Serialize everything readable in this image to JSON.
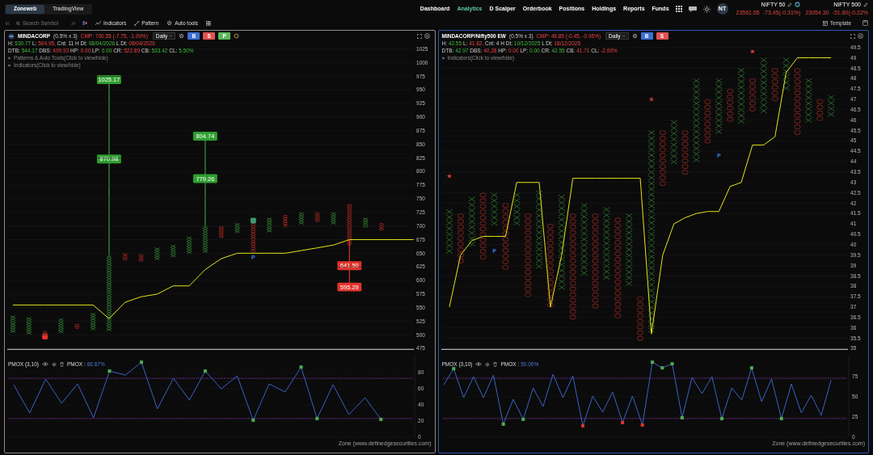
{
  "top_bar": {
    "tabs": [
      {
        "label": "Zoneweb",
        "selected": true
      },
      {
        "label": "TradingView",
        "selected": false
      }
    ],
    "nav": [
      {
        "label": "Dashboard",
        "selected": false
      },
      {
        "label": "Analytics",
        "selected": true
      },
      {
        "label": "D Scalper",
        "selected": false
      },
      {
        "label": "Orderbook",
        "selected": false
      },
      {
        "label": "Positions",
        "selected": false
      },
      {
        "label": "Holdings",
        "selected": false
      },
      {
        "label": "Reports",
        "selected": false
      },
      {
        "label": "Funds",
        "selected": false
      }
    ],
    "avatar": "NT",
    "indices": [
      {
        "name": "NIFTY 50",
        "value": "23561.65",
        "change": "-73.45(-0.31%)"
      },
      {
        "name": "NIFTY 500",
        "value": "23054.30",
        "change": "-51.80(-0.22%"
      }
    ]
  },
  "toolbar": {
    "search": {
      "placeholder": "Search Symbol"
    },
    "tools": [
      "Indicators",
      "Pattern",
      "Auto tools"
    ],
    "template": "Template"
  },
  "panes": [
    {
      "active": false,
      "symbol": "MINDACORP",
      "box": "(0.5% x 3)",
      "cmp": "CMP: 700.55 (-7.75, -1.09%)",
      "interval": "Daily",
      "buttons": [
        {
          "label": "B",
          "color": "#3b6fd4"
        },
        {
          "label": "S",
          "color": "#e05252"
        },
        {
          "label": "P",
          "color": "#5cb85c"
        }
      ],
      "stats": [
        [
          {
            "label": "H:",
            "value": "530.77",
            "kind": "gain"
          },
          {
            "label": "L:",
            "value": "504.95,",
            "kind": "loss"
          },
          {
            "label": "Cnt:",
            "value": "11",
            "kind": "plain"
          },
          {
            "label": "H Dt:",
            "value": "08/04/2026",
            "kind": "gain"
          },
          {
            "label": "L Dt:",
            "value": "08/04/2026",
            "kind": "loss"
          }
        ],
        [
          {
            "label": "DTB:",
            "value": "544.17",
            "kind": "gain"
          },
          {
            "label": "DBS:",
            "value": "499.93",
            "kind": "loss"
          },
          {
            "label": "HP:",
            "value": "0.00",
            "kind": "loss"
          },
          {
            "label": "LP:",
            "value": "0.00",
            "kind": "gain"
          },
          {
            "label": "CR:",
            "value": "522.89",
            "kind": "loss"
          },
          {
            "label": "CB:",
            "value": "533.42",
            "kind": "gain"
          },
          {
            "label": "CL:",
            "value": "5.50%",
            "kind": "gain"
          }
        ]
      ],
      "toggles": [
        "Patterns & Auto Tools(Click to view/hide)",
        "Indicators(Click to view/hide)"
      ],
      "chart_data": {
        "type": "line",
        "grid": true,
        "categories": [
          null,
          null,
          null,
          null,
          null,
          null,
          null,
          null,
          null,
          null,
          null,
          null,
          null,
          null,
          null,
          null,
          null,
          null,
          null,
          null,
          null,
          null,
          null,
          null,
          null,
          null
        ],
        "ylim": [
          475,
          1025
        ],
        "yticks": [
          475,
          500,
          525,
          550,
          575,
          600,
          625,
          650,
          675,
          700,
          725,
          750,
          775,
          800,
          825,
          850,
          875,
          900,
          925,
          950,
          975,
          1000,
          1025
        ],
        "series": [
          {
            "color": "#e5e51a",
            "values": [
              555,
              555,
              555,
              555,
              555,
              555,
              530,
              560,
              570,
              575,
              590,
              590,
              620,
              640,
              650,
              650,
              650,
              650,
              655,
              660,
              665,
              675,
              675,
              675,
              675,
              675
            ]
          }
        ]
      },
      "pnf_columns": [
        {
          "kind": "x"
        },
        {
          "kind": "x"
        },
        {
          "kind": "o"
        },
        {
          "kind": "x"
        },
        {
          "kind": "o"
        },
        {
          "kind": "x"
        },
        {
          "kind": "x"
        },
        {
          "kind": "o"
        },
        {
          "kind": "o"
        },
        {
          "kind": "x"
        },
        {
          "kind": "x"
        },
        {
          "kind": "x"
        },
        {
          "kind": "x"
        },
        {
          "kind": "o"
        },
        {
          "kind": "x"
        },
        {
          "kind": "o"
        },
        {
          "kind": "x"
        },
        {
          "kind": "o"
        },
        {
          "kind": "x"
        },
        {
          "kind": "o"
        },
        {
          "kind": "x"
        },
        {
          "kind": "o"
        },
        {
          "kind": "x"
        },
        {
          "kind": "o"
        }
      ],
      "overlays": [
        {
          "kind": "line",
          "color": "#3c9a3c"
        },
        {
          "kind": "line",
          "color": "#3c9a3c"
        },
        {
          "kind": "line",
          "color": "#e0342c"
        },
        {
          "kind": "label",
          "text": "1025.17",
          "color": "#2f9e2f"
        },
        {
          "kind": "label",
          "text": "870.98",
          "color": "#2f9e2f"
        },
        {
          "kind": "label",
          "text": "804.74",
          "color": "#2f9e2f"
        },
        {
          "kind": "label",
          "text": "779.26",
          "color": "#2f9e2f"
        },
        {
          "kind": "label",
          "text": "641.50",
          "color": "#e0342c"
        },
        {
          "kind": "label",
          "text": "595.29",
          "color": "#e0342c"
        },
        {
          "kind": "badge",
          "color": "#e0342c"
        },
        {
          "kind": "badge",
          "color": "#3c9a6c"
        },
        {
          "kind": "text",
          "text": "P"
        }
      ],
      "indicator": {
        "name": "PMOX (3,10)",
        "reading_label": "PMOX :",
        "reading": "66.67%",
        "chart_data": {
          "type": "line",
          "categories": [
            null,
            null,
            null,
            null,
            null,
            null,
            null,
            null,
            null,
            null,
            null,
            null,
            null,
            null,
            null,
            null,
            null,
            null,
            null,
            null,
            null,
            null,
            null,
            null
          ],
          "ylim": [
            0,
            100
          ],
          "yticks": [
            0,
            20,
            40,
            60,
            80
          ],
          "ref_lines": [
            {
              "axis": "y",
              "value": 73
            },
            {
              "axis": "y",
              "value": 23
            }
          ],
          "series": [
            {
              "color": "#3a62c4",
              "values": [
                65,
                30,
                72,
                42,
                66,
                24,
                82,
                77,
                93,
                35,
                73,
                46,
                82,
                60,
                76,
                21,
                66,
                56,
                87,
                23,
                65,
                28,
                49,
                22
              ]
            }
          ]
        },
        "signals": [
          {
            "kind": "buy"
          },
          {
            "kind": "buy"
          },
          {
            "kind": "buy"
          },
          {
            "kind": "buy"
          },
          {
            "kind": "buy"
          },
          {
            "kind": "buy"
          },
          {
            "kind": "buy"
          }
        ]
      },
      "footer": "Zone (www.definedgesecurities.com)"
    },
    {
      "active": true,
      "symbol": "MINDACORP/Nifty500 EW",
      "box": "(0.5% x 3)",
      "cmp": "CMP: 46.85 (-0.45, -0.95%)",
      "interval": "Daily",
      "buttons": [
        {
          "label": "B",
          "color": "#3b6fd4"
        },
        {
          "label": "S",
          "color": "#e05252"
        }
      ],
      "stats": [
        [
          {
            "label": "H:",
            "value": "42.55",
            "kind": "gain"
          },
          {
            "label": "L:",
            "value": "41.82,",
            "kind": "loss"
          },
          {
            "label": "Cnt:",
            "value": "4",
            "kind": "plain"
          },
          {
            "label": "H Dt:",
            "value": "10/12/2025",
            "kind": "gain"
          },
          {
            "label": "L Dt:",
            "value": "18/12/2025",
            "kind": "loss"
          }
        ],
        [
          {
            "label": "DTB:",
            "value": "42.97",
            "kind": "gain"
          },
          {
            "label": "DBS:",
            "value": "40.28",
            "kind": "loss"
          },
          {
            "label": "HP:",
            "value": "0.00",
            "kind": "loss"
          },
          {
            "label": "LP:",
            "value": "0.00",
            "kind": "gain"
          },
          {
            "label": "CR:",
            "value": "42.55",
            "kind": "gain"
          },
          {
            "label": "CB:",
            "value": "41.71",
            "kind": "loss"
          },
          {
            "label": "CL:",
            "value": "-2.00%",
            "kind": "loss"
          }
        ]
      ],
      "toggles": [
        "Indicators(Click to view/hide)"
      ],
      "chart_data": {
        "type": "line",
        "grid": true,
        "categories": [
          null,
          null,
          null,
          null,
          null,
          null,
          null,
          null,
          null,
          null,
          null,
          null,
          null,
          null,
          null,
          null,
          null,
          null,
          null,
          null,
          null,
          null,
          null,
          null,
          null,
          null,
          null,
          null,
          null,
          null,
          null,
          null,
          null,
          null,
          null
        ],
        "ylim": [
          35,
          49.5
        ],
        "yticks": [
          35,
          35.5,
          36,
          36.5,
          37,
          37.5,
          38,
          38.5,
          39,
          39.5,
          40,
          40.5,
          41,
          41.5,
          42,
          42.5,
          43,
          43.5,
          44,
          44.5,
          45,
          45.5,
          46,
          46.5,
          47,
          47.5,
          48,
          48.5,
          49,
          49.5
        ],
        "series": [
          {
            "color": "#e5e51a",
            "values": [
              37,
              39.5,
              40.2,
              40.4,
              40.4,
              40.4,
              43,
              43,
              43,
              37,
              39.5,
              43.2,
              43.2,
              43.2,
              43.2,
              43.2,
              43.2,
              43.2,
              35.7,
              39.5,
              41,
              41.3,
              41.5,
              41.6,
              41.6,
              42.8,
              43,
              44.8,
              44.8,
              45.2,
              48.3,
              49,
              49,
              49,
              49
            ]
          }
        ]
      },
      "pnf_columns": [
        {
          "kind": "x"
        },
        {
          "kind": "o"
        },
        {
          "kind": "x"
        },
        {
          "kind": "o"
        },
        {
          "kind": "x"
        },
        {
          "kind": "o"
        },
        {
          "kind": "x"
        },
        {
          "kind": "o"
        },
        {
          "kind": "x"
        },
        {
          "kind": "o"
        },
        {
          "kind": "x"
        },
        {
          "kind": "o"
        },
        {
          "kind": "x"
        },
        {
          "kind": "o"
        },
        {
          "kind": "x"
        },
        {
          "kind": "o"
        },
        {
          "kind": "x"
        },
        {
          "kind": "o"
        },
        {
          "kind": "x"
        },
        {
          "kind": "o"
        },
        {
          "kind": "x"
        },
        {
          "kind": "o"
        },
        {
          "kind": "x"
        },
        {
          "kind": "o"
        },
        {
          "kind": "x"
        },
        {
          "kind": "o"
        },
        {
          "kind": "x"
        },
        {
          "kind": "o"
        },
        {
          "kind": "x"
        },
        {
          "kind": "o"
        },
        {
          "kind": "x"
        },
        {
          "kind": "o"
        },
        {
          "kind": "x"
        },
        {
          "kind": "o"
        },
        {
          "kind": "x"
        }
      ],
      "overlays": [
        {
          "kind": "star"
        },
        {
          "kind": "star"
        },
        {
          "kind": "star"
        },
        {
          "kind": "text",
          "text": "P"
        },
        {
          "kind": "text",
          "text": "P"
        }
      ],
      "indicator": {
        "name": "PMOX (3,10)",
        "reading_label": "PMOX :",
        "reading": "50.00%",
        "chart_data": {
          "type": "line",
          "categories": [
            null,
            null,
            null,
            null,
            null,
            null,
            null,
            null,
            null,
            null,
            null,
            null,
            null,
            null,
            null,
            null,
            null,
            null,
            null,
            null,
            null,
            null,
            null,
            null,
            null,
            null,
            null,
            null,
            null,
            null,
            null,
            null,
            null,
            null,
            null,
            null,
            null,
            null,
            null,
            null
          ],
          "ylim": [
            0,
            100
          ],
          "yticks": [
            0,
            25,
            50,
            75
          ],
          "ref_lines": [
            {
              "axis": "y",
              "value": 73
            },
            {
              "axis": "y",
              "value": 23
            }
          ],
          "series": [
            {
              "color": "#3a62c4",
              "values": [
                65,
                85,
                49,
                75,
                49,
                77,
                16,
                47,
                22,
                61,
                38,
                78,
                49,
                76,
                14,
                51,
                31,
                56,
                18,
                51,
                15,
                93,
                86,
                91,
                24,
                74,
                54,
                75,
                23,
                61,
                46,
                86,
                44,
                72,
                23,
                66,
                30,
                52,
                27,
                71
              ]
            }
          ]
        },
        "signals": [
          {
            "kind": "buy"
          },
          {
            "kind": "buy"
          },
          {
            "kind": "buy"
          },
          {
            "kind": "sell"
          },
          {
            "kind": "sell"
          },
          {
            "kind": "sell"
          },
          {
            "kind": "buy"
          },
          {
            "kind": "buy"
          },
          {
            "kind": "buy"
          },
          {
            "kind": "buy"
          },
          {
            "kind": "buy"
          },
          {
            "kind": "buy"
          },
          {
            "kind": "buy"
          }
        ]
      },
      "footer": "Zone (www.definedgesecurities.com)"
    }
  ]
}
